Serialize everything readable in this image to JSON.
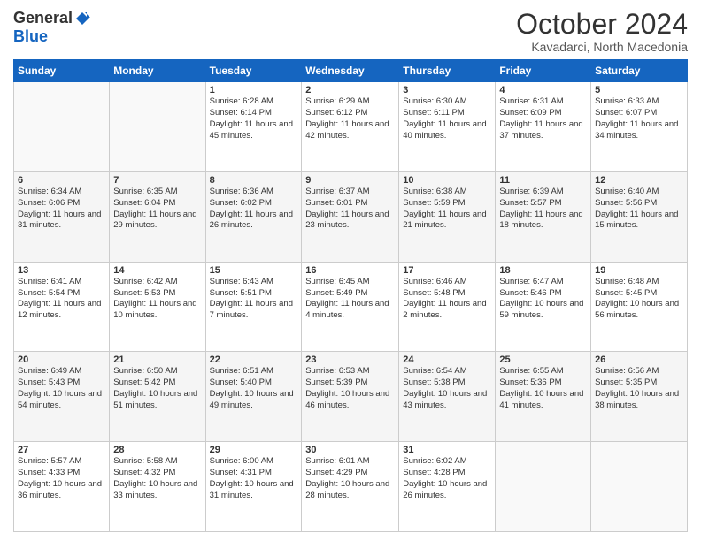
{
  "header": {
    "logo_general": "General",
    "logo_blue": "Blue",
    "month_title": "October 2024",
    "location": "Kavadarci, North Macedonia"
  },
  "days_of_week": [
    "Sunday",
    "Monday",
    "Tuesday",
    "Wednesday",
    "Thursday",
    "Friday",
    "Saturday"
  ],
  "weeks": [
    [
      {
        "day": "",
        "info": ""
      },
      {
        "day": "",
        "info": ""
      },
      {
        "day": "1",
        "info": "Sunrise: 6:28 AM\nSunset: 6:14 PM\nDaylight: 11 hours and 45 minutes."
      },
      {
        "day": "2",
        "info": "Sunrise: 6:29 AM\nSunset: 6:12 PM\nDaylight: 11 hours and 42 minutes."
      },
      {
        "day": "3",
        "info": "Sunrise: 6:30 AM\nSunset: 6:11 PM\nDaylight: 11 hours and 40 minutes."
      },
      {
        "day": "4",
        "info": "Sunrise: 6:31 AM\nSunset: 6:09 PM\nDaylight: 11 hours and 37 minutes."
      },
      {
        "day": "5",
        "info": "Sunrise: 6:33 AM\nSunset: 6:07 PM\nDaylight: 11 hours and 34 minutes."
      }
    ],
    [
      {
        "day": "6",
        "info": "Sunrise: 6:34 AM\nSunset: 6:06 PM\nDaylight: 11 hours and 31 minutes."
      },
      {
        "day": "7",
        "info": "Sunrise: 6:35 AM\nSunset: 6:04 PM\nDaylight: 11 hours and 29 minutes."
      },
      {
        "day": "8",
        "info": "Sunrise: 6:36 AM\nSunset: 6:02 PM\nDaylight: 11 hours and 26 minutes."
      },
      {
        "day": "9",
        "info": "Sunrise: 6:37 AM\nSunset: 6:01 PM\nDaylight: 11 hours and 23 minutes."
      },
      {
        "day": "10",
        "info": "Sunrise: 6:38 AM\nSunset: 5:59 PM\nDaylight: 11 hours and 21 minutes."
      },
      {
        "day": "11",
        "info": "Sunrise: 6:39 AM\nSunset: 5:57 PM\nDaylight: 11 hours and 18 minutes."
      },
      {
        "day": "12",
        "info": "Sunrise: 6:40 AM\nSunset: 5:56 PM\nDaylight: 11 hours and 15 minutes."
      }
    ],
    [
      {
        "day": "13",
        "info": "Sunrise: 6:41 AM\nSunset: 5:54 PM\nDaylight: 11 hours and 12 minutes."
      },
      {
        "day": "14",
        "info": "Sunrise: 6:42 AM\nSunset: 5:53 PM\nDaylight: 11 hours and 10 minutes."
      },
      {
        "day": "15",
        "info": "Sunrise: 6:43 AM\nSunset: 5:51 PM\nDaylight: 11 hours and 7 minutes."
      },
      {
        "day": "16",
        "info": "Sunrise: 6:45 AM\nSunset: 5:49 PM\nDaylight: 11 hours and 4 minutes."
      },
      {
        "day": "17",
        "info": "Sunrise: 6:46 AM\nSunset: 5:48 PM\nDaylight: 11 hours and 2 minutes."
      },
      {
        "day": "18",
        "info": "Sunrise: 6:47 AM\nSunset: 5:46 PM\nDaylight: 10 hours and 59 minutes."
      },
      {
        "day": "19",
        "info": "Sunrise: 6:48 AM\nSunset: 5:45 PM\nDaylight: 10 hours and 56 minutes."
      }
    ],
    [
      {
        "day": "20",
        "info": "Sunrise: 6:49 AM\nSunset: 5:43 PM\nDaylight: 10 hours and 54 minutes."
      },
      {
        "day": "21",
        "info": "Sunrise: 6:50 AM\nSunset: 5:42 PM\nDaylight: 10 hours and 51 minutes."
      },
      {
        "day": "22",
        "info": "Sunrise: 6:51 AM\nSunset: 5:40 PM\nDaylight: 10 hours and 49 minutes."
      },
      {
        "day": "23",
        "info": "Sunrise: 6:53 AM\nSunset: 5:39 PM\nDaylight: 10 hours and 46 minutes."
      },
      {
        "day": "24",
        "info": "Sunrise: 6:54 AM\nSunset: 5:38 PM\nDaylight: 10 hours and 43 minutes."
      },
      {
        "day": "25",
        "info": "Sunrise: 6:55 AM\nSunset: 5:36 PM\nDaylight: 10 hours and 41 minutes."
      },
      {
        "day": "26",
        "info": "Sunrise: 6:56 AM\nSunset: 5:35 PM\nDaylight: 10 hours and 38 minutes."
      }
    ],
    [
      {
        "day": "27",
        "info": "Sunrise: 5:57 AM\nSunset: 4:33 PM\nDaylight: 10 hours and 36 minutes."
      },
      {
        "day": "28",
        "info": "Sunrise: 5:58 AM\nSunset: 4:32 PM\nDaylight: 10 hours and 33 minutes."
      },
      {
        "day": "29",
        "info": "Sunrise: 6:00 AM\nSunset: 4:31 PM\nDaylight: 10 hours and 31 minutes."
      },
      {
        "day": "30",
        "info": "Sunrise: 6:01 AM\nSunset: 4:29 PM\nDaylight: 10 hours and 28 minutes."
      },
      {
        "day": "31",
        "info": "Sunrise: 6:02 AM\nSunset: 4:28 PM\nDaylight: 10 hours and 26 minutes."
      },
      {
        "day": "",
        "info": ""
      },
      {
        "day": "",
        "info": ""
      }
    ]
  ]
}
